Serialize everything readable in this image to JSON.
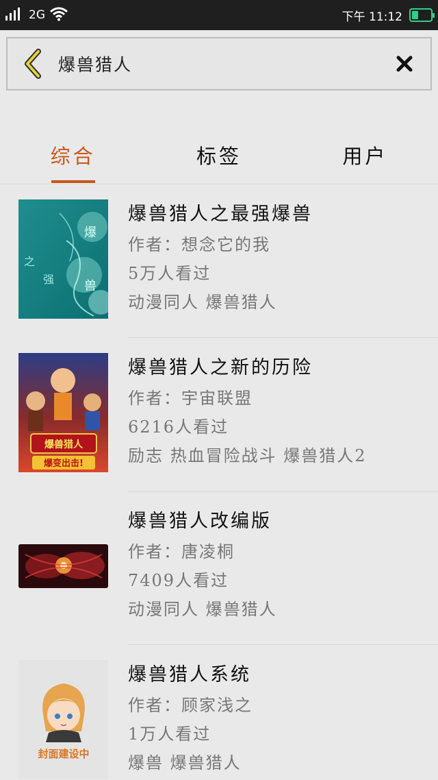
{
  "status_bar": {
    "network": "2G",
    "time": "下午 11:12"
  },
  "search": {
    "query": "爆兽猎人"
  },
  "tabs": [
    {
      "label": "综合",
      "active": true
    },
    {
      "label": "标签",
      "active": false
    },
    {
      "label": "用户",
      "active": false
    }
  ],
  "results": [
    {
      "title": "爆兽猎人之最强爆兽",
      "author": "作者：想念它的我",
      "views": "5万人看过",
      "tags": "动漫同人 爆兽猎人",
      "cover_text": [
        "爆",
        "兽",
        "之",
        "强"
      ]
    },
    {
      "title": "爆兽猎人之新的历险",
      "author": "作者：宇宙联盟",
      "views": "6216人看过",
      "tags": "励志 热血冒险战斗 爆兽猎人2",
      "cover_text": [
        "爆兽猎人",
        "爆变出击!"
      ]
    },
    {
      "title": "爆兽猎人改编版",
      "author": "作者：唐凌桐",
      "views": "7409人看过",
      "tags": "动漫同人 爆兽猎人"
    },
    {
      "title": "爆兽猎人系统",
      "author": "作者：顾家浅之",
      "views": "1万人看过",
      "tags": "爆兽 爆兽猎人",
      "cover_text": [
        "封面建设中"
      ]
    }
  ]
}
